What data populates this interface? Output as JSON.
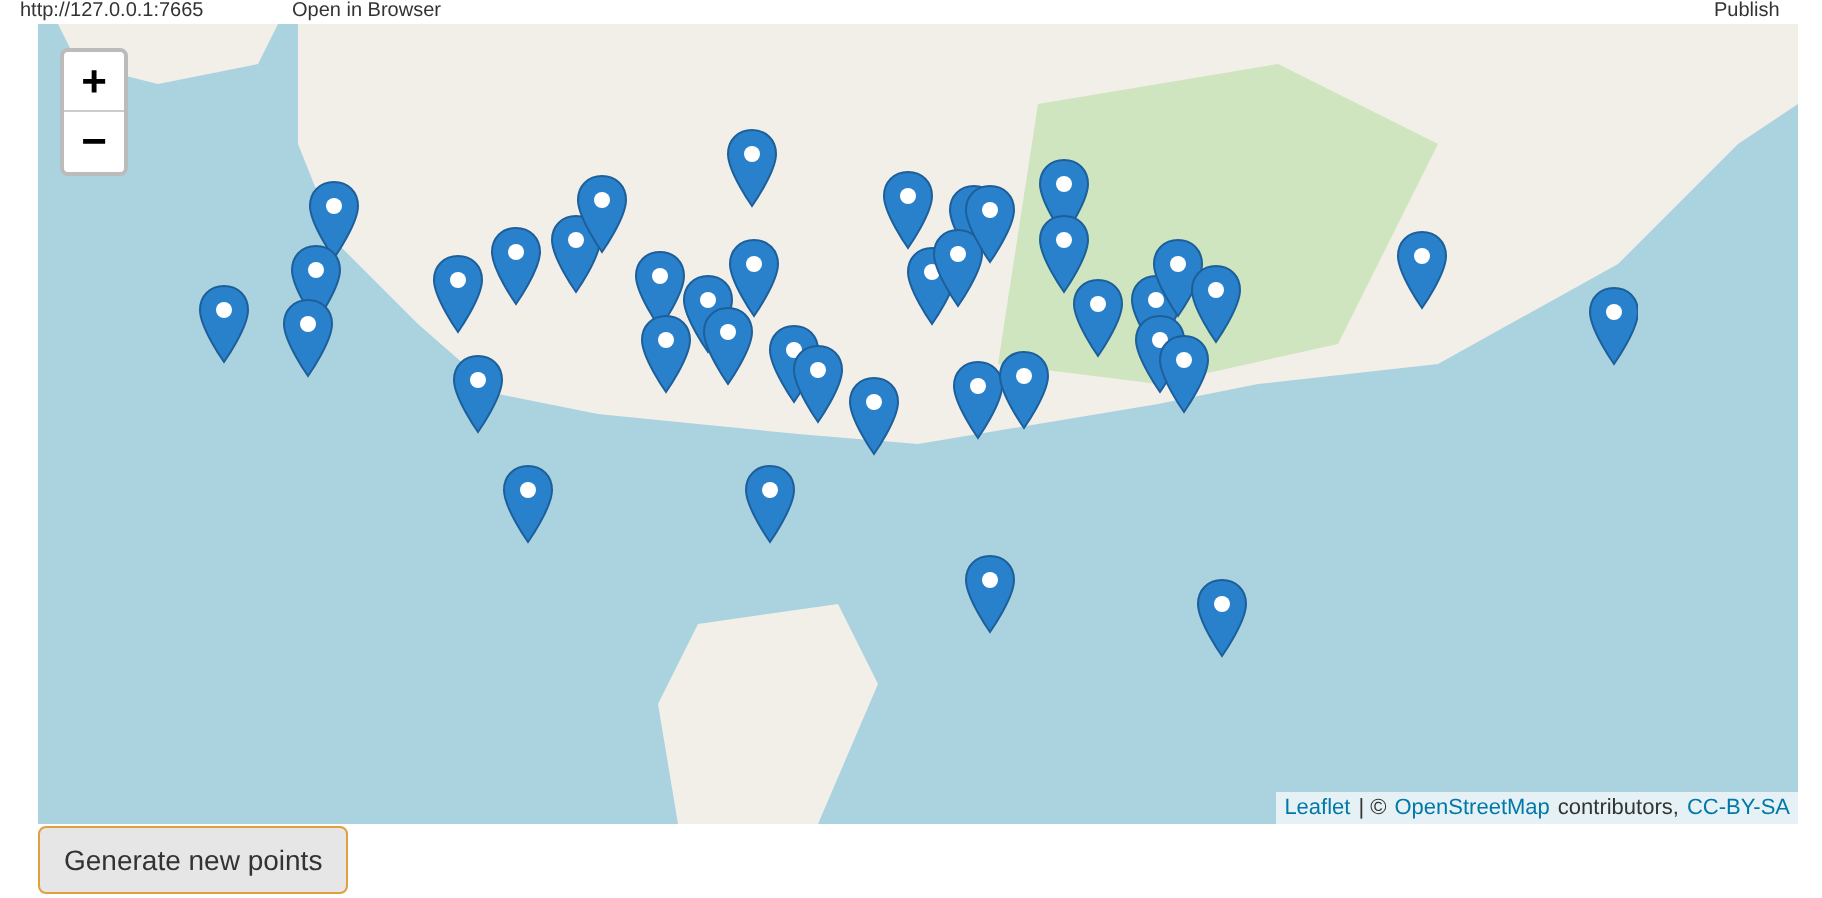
{
  "toolbar": {
    "url": "http://127.0.0.1:7665",
    "open_in_browser": "Open in Browser",
    "publish": "Publish"
  },
  "map": {
    "zoom_in": "+",
    "zoom_out": "−",
    "attribution": {
      "leaflet": "Leaflet",
      "separator": "| ©",
      "osm": "OpenStreetMap",
      "contributors": "contributors,",
      "license": "CC-BY-SA"
    }
  },
  "generate_button": "Generate new points"
}
